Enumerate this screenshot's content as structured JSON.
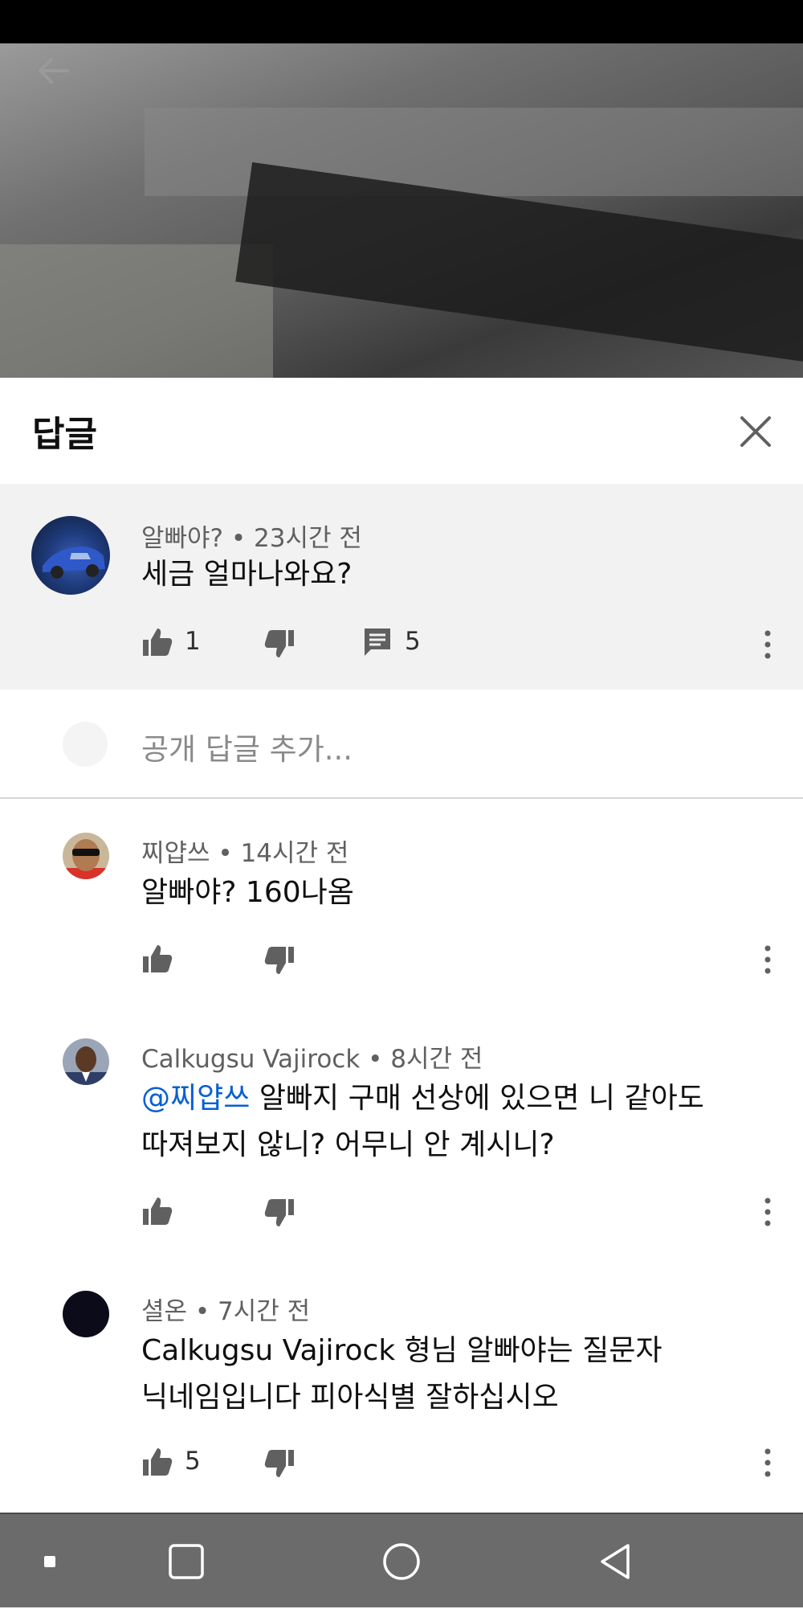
{
  "header": {
    "title": "답글",
    "close_icon": "close-icon"
  },
  "parent_comment": {
    "author": "알빠야?",
    "time": "23시간 전",
    "text": "세금 얼마나와요?",
    "likes": "1",
    "replies": "5"
  },
  "add_reply": {
    "placeholder": "공개 답글 추가..."
  },
  "replies": [
    {
      "author": "찌얍쓰",
      "time": "14시간 전",
      "lines": [
        "알빠야? 160나옴"
      ],
      "likes": ""
    },
    {
      "author": "Calkugsu Vajirock",
      "time": "8시간 전",
      "mention": "@찌얍쓰",
      "lines": [
        " 알빠지 구매 선상에 있으면 니 같아도",
        "따져보지 않니? 어무니 안 계시니?"
      ],
      "likes": ""
    },
    {
      "author": "셜온",
      "time": "7시간 전",
      "lines": [
        "Calkugsu Vajirock 형님 알빠야는 질문자",
        "닉네임입니다 피아식별 잘하십시오"
      ],
      "likes": "5"
    }
  ],
  "meta_sep": " • ",
  "colors": {
    "link": "#065fd4",
    "parent_bg": "#f2f2f2",
    "nav_bg": "#6b6b6b"
  }
}
